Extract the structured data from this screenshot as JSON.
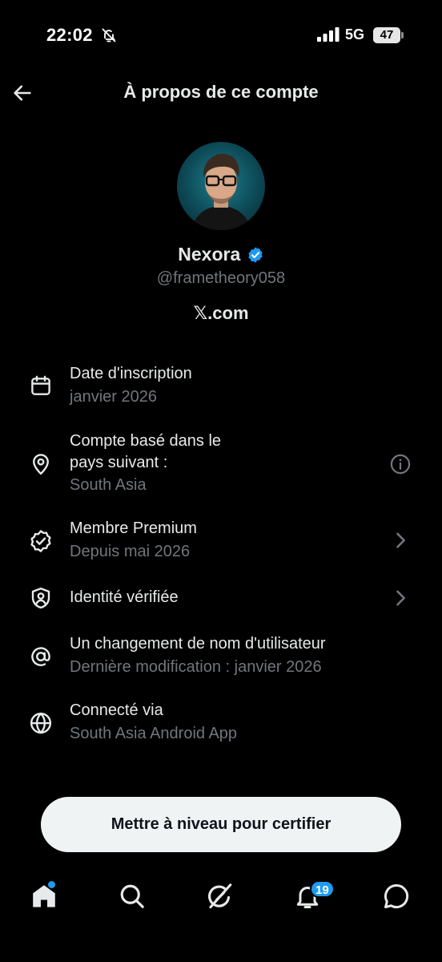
{
  "status_bar": {
    "time": "22:02",
    "network": "5G",
    "battery": "47"
  },
  "header": {
    "title": "À propos de ce compte"
  },
  "profile": {
    "name": "Nexora",
    "handle": "@frametheory058",
    "site": "𝕏.com"
  },
  "rows": [
    {
      "title": "Date d'inscription",
      "subtitle": "janvier 2026",
      "icon": "calendar-icon"
    },
    {
      "title_line1": "Compte basé dans le",
      "title_line2": "pays suivant :",
      "subtitle": "South Asia",
      "icon": "location-pin-icon",
      "right_icon": "info-icon"
    },
    {
      "title": "Membre Premium",
      "subtitle": "Depuis mai 2026",
      "icon": "verified-badge-icon",
      "right_icon": "chevron-right-icon"
    },
    {
      "title": "Identité vérifiée",
      "icon": "shield-user-icon",
      "right_icon": "chevron-right-icon"
    },
    {
      "title": "Un changement de nom d'utilisateur",
      "subtitle": "Dernière modification : janvier 2026",
      "icon": "at-sign-icon"
    },
    {
      "title": "Connecté via",
      "subtitle": "South Asia Android App",
      "icon": "globe-icon"
    }
  ],
  "cta": {
    "label": "Mettre à niveau pour certifier"
  },
  "nav": {
    "notifications_count": "19",
    "items": [
      "home-icon",
      "search-icon",
      "grok-icon",
      "bell-icon",
      "chat-icon"
    ]
  },
  "colors": {
    "background": "#000000",
    "primary_text": "#e7e9ea",
    "secondary_text": "#71767b",
    "accent": "#1d9bf0",
    "cta_bg": "#eff3f4"
  }
}
